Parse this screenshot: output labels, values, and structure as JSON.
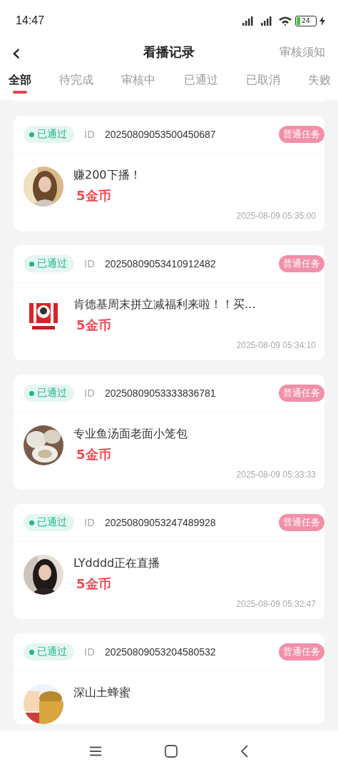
{
  "status_bar": {
    "time": "14:47",
    "battery": "24"
  },
  "header": {
    "back": "‹",
    "title": "看播记录",
    "action": "审核须知"
  },
  "tabs": [
    {
      "label": "全部",
      "selected": true
    },
    {
      "label": "待完成",
      "selected": false
    },
    {
      "label": "审核中",
      "selected": false
    },
    {
      "label": "已通过",
      "selected": false
    },
    {
      "label": "已取消",
      "selected": false
    },
    {
      "label": "失败",
      "selected": false
    }
  ],
  "records": [
    {
      "status": "已通过",
      "color": "#1fb58a",
      "id_label": "ID",
      "id": "20250809053500450687",
      "tag": "普通任务",
      "title": "赚200下播！",
      "reward": "5金币",
      "time": "2025-08-09 05:35:00"
    },
    {
      "status": "已通过",
      "color": "#1fb58a",
      "id_label": "ID",
      "id": "20250809053410912482",
      "tag": "普通任务",
      "title": "肯德基周末拼立减福利来啦！！买...",
      "reward": "5金币",
      "time": "2025-08-09 05:34:10"
    },
    {
      "status": "已通过",
      "color": "#1fb58a",
      "id_label": "ID",
      "id": "20250809053333836781",
      "tag": "普通任务",
      "title": "专业鱼汤面老面小笼包",
      "reward": "5金币",
      "time": "2025-08-09 05:33:33"
    },
    {
      "status": "已通过",
      "color": "#1fb58a",
      "id_label": "ID",
      "id": "20250809053247489928",
      "tag": "普通任务",
      "title": "LYdddd正在直播",
      "reward": "5金币",
      "time": "2025-08-09 05:32:47"
    },
    {
      "status": "已通过",
      "color": "#1fb58a",
      "id_label": "ID",
      "id": "20250809053204580532",
      "tag": "普通任务",
      "title": "深山土蜂蜜"
    }
  ]
}
